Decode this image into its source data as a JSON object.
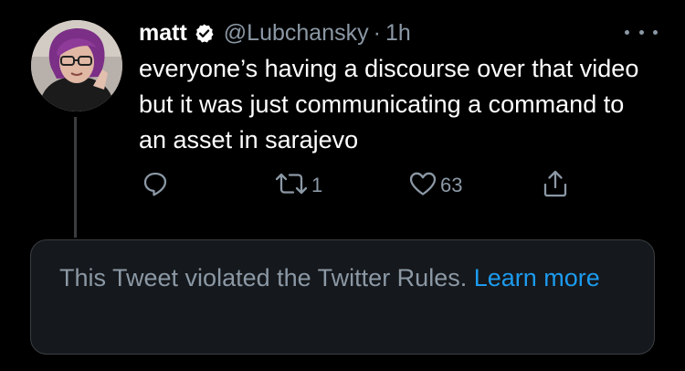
{
  "tweet": {
    "author_name": "matt",
    "handle": "@Lubchansky",
    "separator": "·",
    "time": "1h",
    "text": "everyone’s having a discourse over that video but it was just communicating a command to an asset in sarajevo",
    "avatar_icon": "user-avatar",
    "verified_icon": "verified-badge-icon",
    "more_icon": "more-options-icon"
  },
  "actions": {
    "reply_icon": "reply-icon",
    "retweet_icon": "retweet-icon",
    "retweet_count": "1",
    "like_icon": "heart-icon",
    "like_count": "63",
    "share_icon": "share-icon"
  },
  "notice": {
    "text": "This Tweet violated the Twitter Rules.",
    "link": "Learn more"
  },
  "colors": {
    "background": "#000000",
    "primary_text": "#ffffff",
    "secondary_text": "#8b98a5",
    "link": "#1d9bf0",
    "notice_background": "#15181c",
    "border": "#3a3d40"
  }
}
